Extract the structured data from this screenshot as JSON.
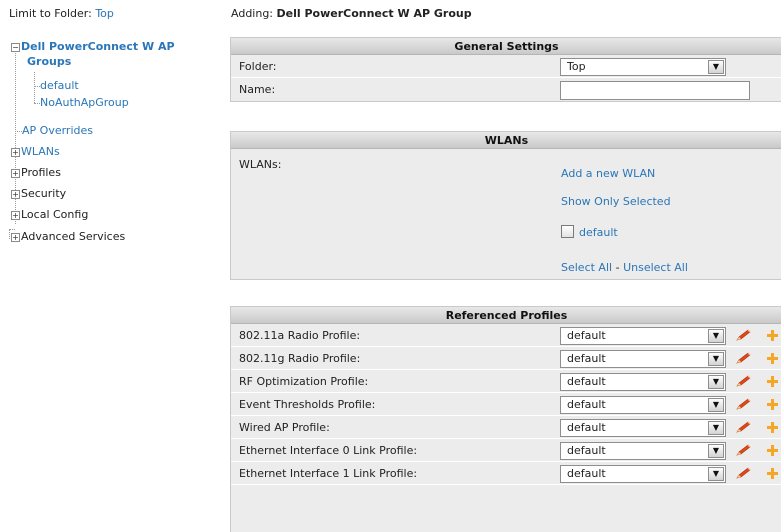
{
  "sidebar": {
    "folder_label": "Limit to Folder:",
    "folder_value": "Top",
    "root_line1": "Dell PowerConnect W AP",
    "root_line2": "Groups",
    "children": [
      "default",
      "NoAuthApGroup"
    ],
    "items": [
      "AP Overrides",
      "WLANs",
      "Profiles",
      "Security",
      "Local Config",
      "Advanced Services"
    ]
  },
  "main": {
    "adding_label": "Adding:",
    "adding_value": "Dell PowerConnect W AP Group",
    "general": {
      "title": "General Settings",
      "folder_label": "Folder:",
      "folder_value": "Top",
      "name_label": "Name:",
      "name_value": ""
    },
    "wlans": {
      "title": "WLANs",
      "label": "WLANs:",
      "add_link": "Add a new WLAN",
      "show_selected_link": "Show Only Selected",
      "option_default": "default",
      "select_all": "Select All",
      "separator": "-",
      "unselect_all": "Unselect All"
    },
    "profiles": {
      "title": "Referenced Profiles",
      "rows": [
        {
          "label": "802.11a Radio Profile:",
          "value": "default"
        },
        {
          "label": "802.11g Radio Profile:",
          "value": "default"
        },
        {
          "label": "RF Optimization Profile:",
          "value": "default"
        },
        {
          "label": "Event Thresholds Profile:",
          "value": "default"
        },
        {
          "label": "Wired AP Profile:",
          "value": "default"
        },
        {
          "label": "Ethernet Interface 0 Link Profile:",
          "value": "default"
        },
        {
          "label": "Ethernet Interface 1 Link Profile:",
          "value": "default"
        }
      ]
    }
  },
  "colors": {
    "link": "#2a76b8",
    "panel_bg": "#ececec",
    "edit_icon": "#e04a18",
    "add_icon": "#f5a623"
  },
  "icons": {
    "expand": "plus-box-icon",
    "collapse": "minus-box-icon",
    "edit": "pencil-icon",
    "add": "plus-icon",
    "dropdown": "chevron-down-icon"
  }
}
